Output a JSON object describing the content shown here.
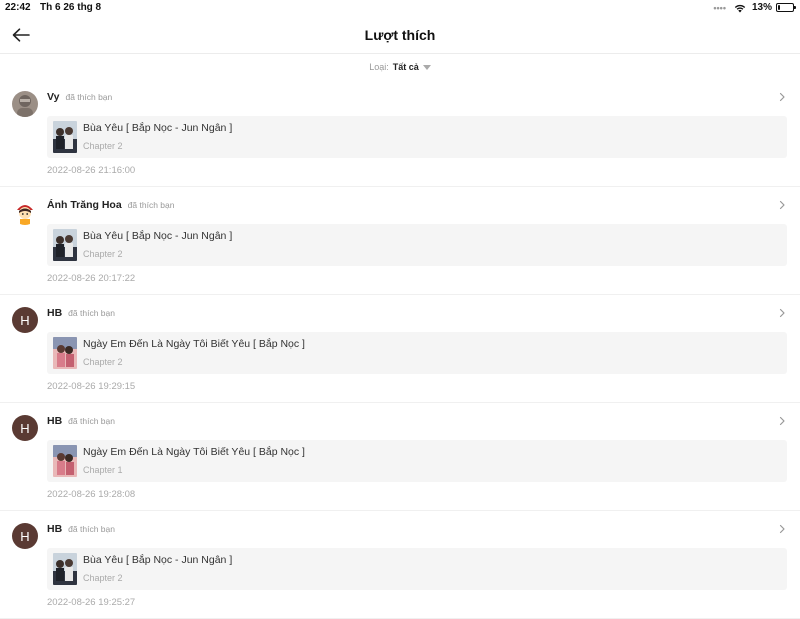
{
  "status": {
    "time": "22:42",
    "date": "Th 6 26 thg 8",
    "battery": "13%",
    "battery_level": 0.13
  },
  "nav": {
    "title": "Lượt thích"
  },
  "filter": {
    "label": "Loại:",
    "value": "Tất cả"
  },
  "items": [
    {
      "name": "Vy",
      "action": "đã thích bạn",
      "avatar": "photo",
      "story": "Bùa Yêu [ Bắp Nọc - Jun Ngân ]",
      "chapter": "Chapter 2",
      "time": "2022-08-26 21:16:00"
    },
    {
      "name": "Ánh Trăng Hoa",
      "action": "đã thích bạn",
      "avatar": "cartoon",
      "story": "Bùa Yêu [ Bắp Nọc - Jun Ngân ]",
      "chapter": "Chapter 2",
      "time": "2022-08-26 20:17:22"
    },
    {
      "name": "HB",
      "action": "đã thích bạn",
      "avatar": "H",
      "story": "Ngày Em Đến Là Ngày Tôi Biết Yêu [ Bắp Nọc ]",
      "chapter": "Chapter 2",
      "time": "2022-08-26 19:29:15"
    },
    {
      "name": "HB",
      "action": "đã thích bạn",
      "avatar": "H",
      "story": "Ngày Em Đến Là Ngày Tôi Biết Yêu [ Bắp Nọc ]",
      "chapter": "Chapter 1",
      "time": "2022-08-26 19:28:08"
    },
    {
      "name": "HB",
      "action": "đã thích bạn",
      "avatar": "H",
      "story": "Bùa Yêu [ Bắp Nọc - Jun Ngân ]",
      "chapter": "Chapter 2",
      "time": "2022-08-26 19:25:27"
    }
  ],
  "colors": {
    "avatar_letter_bg": "#5a3a33",
    "card_bg": "#f5f5f5",
    "muted_text": "#aaaaaa"
  }
}
